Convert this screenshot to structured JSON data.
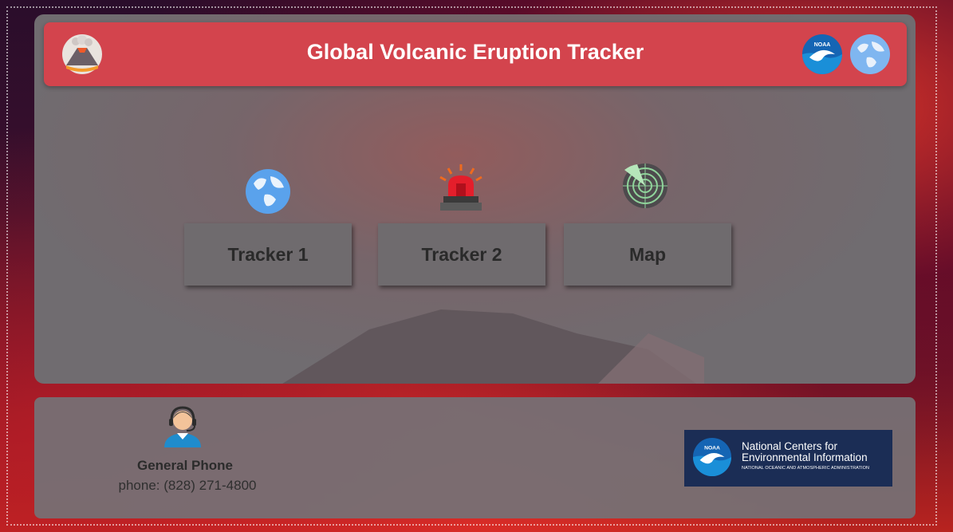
{
  "header": {
    "title": "Global Volcanic Eruption Tracker",
    "left_icon": "volcano-icon",
    "right_icons": [
      "noaa-logo",
      "globe-icon"
    ],
    "noaa_logo_text": "NOAA"
  },
  "nav": {
    "items": [
      {
        "label": "Tracker 1",
        "icon": "globe-icon"
      },
      {
        "label": "Tracker 2",
        "icon": "siren-icon"
      },
      {
        "label": "Map",
        "icon": "radar-icon"
      }
    ]
  },
  "footer": {
    "contact_icon": "support-agent-icon",
    "phone_title": "General Phone",
    "phone_number": "phone: (828) 271-4800",
    "ncei": {
      "line1": "National Centers for",
      "line2": "Environmental Information",
      "line3": "NATIONAL OCEANIC AND ATMOSPHERIC ADMINISTRATION",
      "logo_text": "NOAA"
    }
  },
  "colors": {
    "header_bg": "#d3444d",
    "ncei_bg": "#1b2d55"
  }
}
